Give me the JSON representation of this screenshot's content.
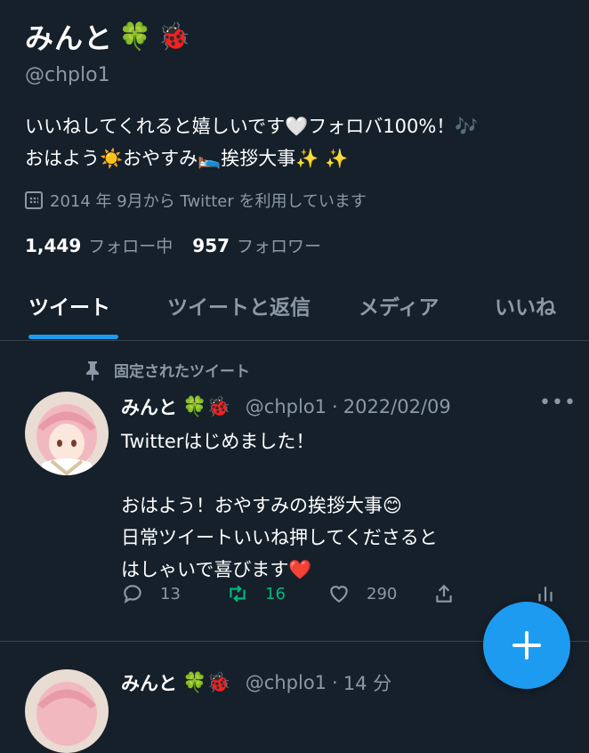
{
  "profile": {
    "name": "みんと",
    "name_emojis": [
      "🍀",
      "🐞"
    ],
    "handle": "@chplo1",
    "bio_line1": "いいねしてくれると嬉しいです🤍フォロバ100%！🎶",
    "bio_line2": "おはよう☀️おやすみ🛌挨拶大事✨ ✨",
    "joined": "2014 年 9月から Twitter を利用しています",
    "following_count": "1,449",
    "following_label": "フォロー中",
    "followers_count": "957",
    "followers_label": "フォロワー"
  },
  "tabs": [
    {
      "label": "ツイート",
      "active": true
    },
    {
      "label": "ツイートと返信",
      "active": false
    },
    {
      "label": "メディア",
      "active": false
    },
    {
      "label": "いいね",
      "active": false
    }
  ],
  "pinned_label": "固定されたツイート",
  "tweets": [
    {
      "name": "みんと",
      "emojis": "🍀🐞",
      "handle": "@chplo1",
      "separator": "·",
      "time": "2022/02/09",
      "text": "Twitterはじめました！\n\nおはよう！おやすみの挨拶大事😊\n日常ツイートいいね押してくださると\nはしゃいで喜びます❤️",
      "reply_count": "13",
      "retweet_count": "16",
      "like_count": "290"
    },
    {
      "name": "みんと",
      "emojis": "🍀🐞",
      "handle": "@chplo1",
      "separator": "·",
      "time": "14 分",
      "text": ""
    }
  ],
  "colors": {
    "background": "#15202b",
    "accent": "#1d9bf0",
    "secondary_text": "#8b98a5",
    "retweet_active": "#00ba7c",
    "divider": "#38444d"
  },
  "icons": {
    "calendar": "calendar-icon",
    "pin": "pin-icon",
    "reply": "reply-icon",
    "retweet": "retweet-icon",
    "like": "heart-icon",
    "share": "share-icon",
    "analytics": "analytics-icon",
    "more": "more-icon",
    "compose": "plus-icon"
  }
}
